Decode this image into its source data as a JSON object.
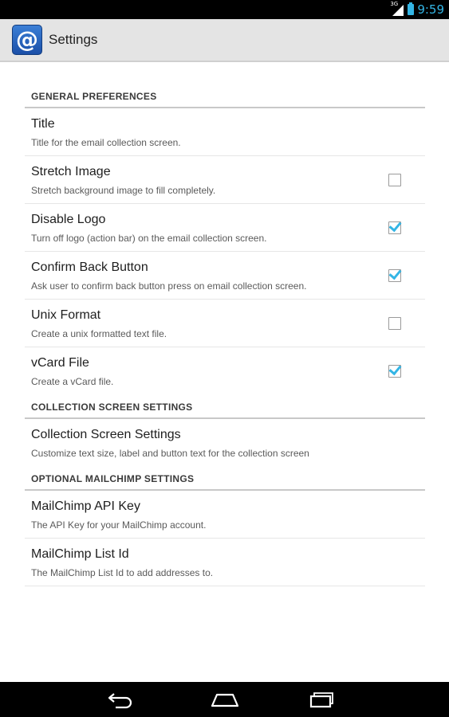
{
  "status_bar": {
    "network": "3G",
    "time": "9:59"
  },
  "action_bar": {
    "icon": "at-sign-icon",
    "icon_glyph": "@",
    "title": "Settings"
  },
  "sections": {
    "general": {
      "header": "GENERAL PREFERENCES",
      "items": [
        {
          "title": "Title",
          "summary": "Title for the email collection screen."
        },
        {
          "title": "Stretch Image",
          "summary": "Stretch background image to fill completely.",
          "checked": false
        },
        {
          "title": "Disable Logo",
          "summary": "Turn off logo (action bar) on the email collection screen.",
          "checked": true
        },
        {
          "title": "Confirm Back Button",
          "summary": "Ask user to confirm back button press on email collection screen.",
          "checked": true
        },
        {
          "title": "Unix Format",
          "summary": "Create a unix formatted text file.",
          "checked": false
        },
        {
          "title": "vCard File",
          "summary": "Create a vCard file.",
          "checked": true
        }
      ]
    },
    "collection": {
      "header": "COLLECTION SCREEN SETTINGS",
      "items": [
        {
          "title": "Collection Screen Settings",
          "summary": "Customize text size, label and button text for the collection screen"
        }
      ]
    },
    "mailchimp": {
      "header": "OPTIONAL MAILCHIMP SETTINGS",
      "items": [
        {
          "title": "MailChimp API Key",
          "summary": "The API Key for your MailChimp account."
        },
        {
          "title": "MailChimp List Id",
          "summary": "The MailChimp List Id to add addresses to."
        }
      ]
    }
  },
  "nav_bar": {
    "buttons": [
      "back-icon",
      "home-icon",
      "recent-apps-icon"
    ]
  },
  "colors": {
    "accent": "#33b5e5",
    "action_bar_bg": "#e4e4e4",
    "status_bar_bg": "#000000"
  }
}
